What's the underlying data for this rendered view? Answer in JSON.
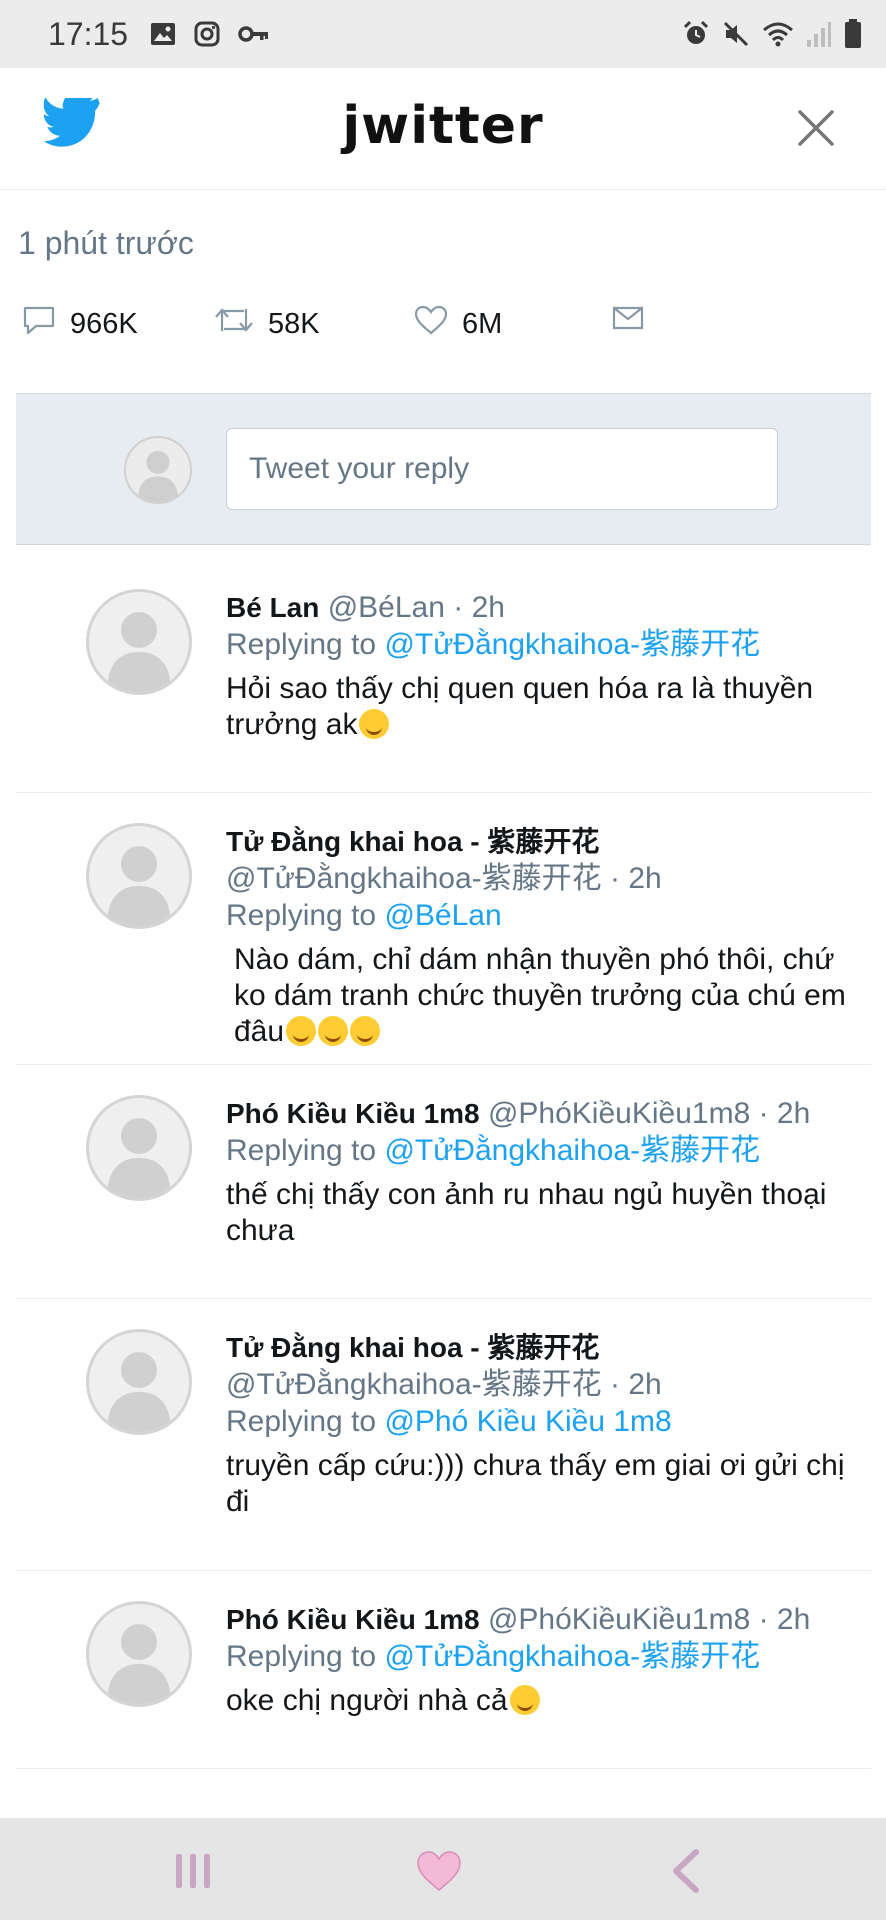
{
  "status_bar": {
    "time": "17:15",
    "left_icons": [
      "gallery-icon",
      "instagram-icon",
      "key-icon"
    ],
    "right_icons": [
      "alarm-icon",
      "mute-icon",
      "wifi-icon",
      "signal-icon",
      "battery-icon"
    ]
  },
  "header": {
    "title": "jwitter",
    "logo_icon": "bird-icon",
    "close_icon": "close-icon",
    "accent_color": "#1da1f2"
  },
  "tweet_meta": {
    "timestamp": "1 phút trước",
    "replies": "966K",
    "retweets": "58K",
    "likes": "6M"
  },
  "composer": {
    "placeholder": "Tweet your reply"
  },
  "replies": [
    {
      "author": "Bé Lan",
      "handle": "@BéLan · 2h",
      "replying_prefix": "Replying to",
      "replying_to": "@TửĐằngkhaihoa-紫藤开花",
      "text": "Hỏi sao thấy chị quen quen hóa ra là thuyền trưởng ak"
    },
    {
      "author": "Tử Đằng khai hoa - 紫藤开花",
      "handle": "@TửĐằngkhaihoa-紫藤开花 · 2h",
      "replying_prefix": "Replying to",
      "replying_to": "@BéLan",
      "text": "Nào dám, chỉ dám nhận thuyền phó thôi, chứ ko dám tranh chức thuyền trưởng của chú em đâu"
    },
    {
      "author": "Phó Kiều Kiều 1m8",
      "handle": "@PhóKiềuKiều1m8 · 2h",
      "replying_prefix": "Replying to",
      "replying_to": "@TửĐằngkhaihoa-紫藤开花",
      "text": "thế chị thấy con ảnh ru nhau ngủ huyền thoại chưa"
    },
    {
      "author": "Tử Đằng khai hoa - 紫藤开花",
      "handle": "@TửĐằngkhaihoa-紫藤开花 · 2h",
      "replying_prefix": "Replying to",
      "replying_to": "@Phó Kiều Kiều 1m8",
      "text": "truyền cấp cứu:))) chưa thấy em giai ơi gửi chị đi"
    },
    {
      "author": "Phó Kiều Kiều 1m8",
      "handle": "@PhóKiềuKiều1m8 · 2h",
      "replying_prefix": "Replying to",
      "replying_to": "@TửĐằngkhaihoa-紫藤开花",
      "text": "oke chị người nhà cả"
    }
  ],
  "nav_bar": {
    "icons": [
      "recents-icon",
      "home-heart-icon",
      "back-icon"
    ]
  }
}
